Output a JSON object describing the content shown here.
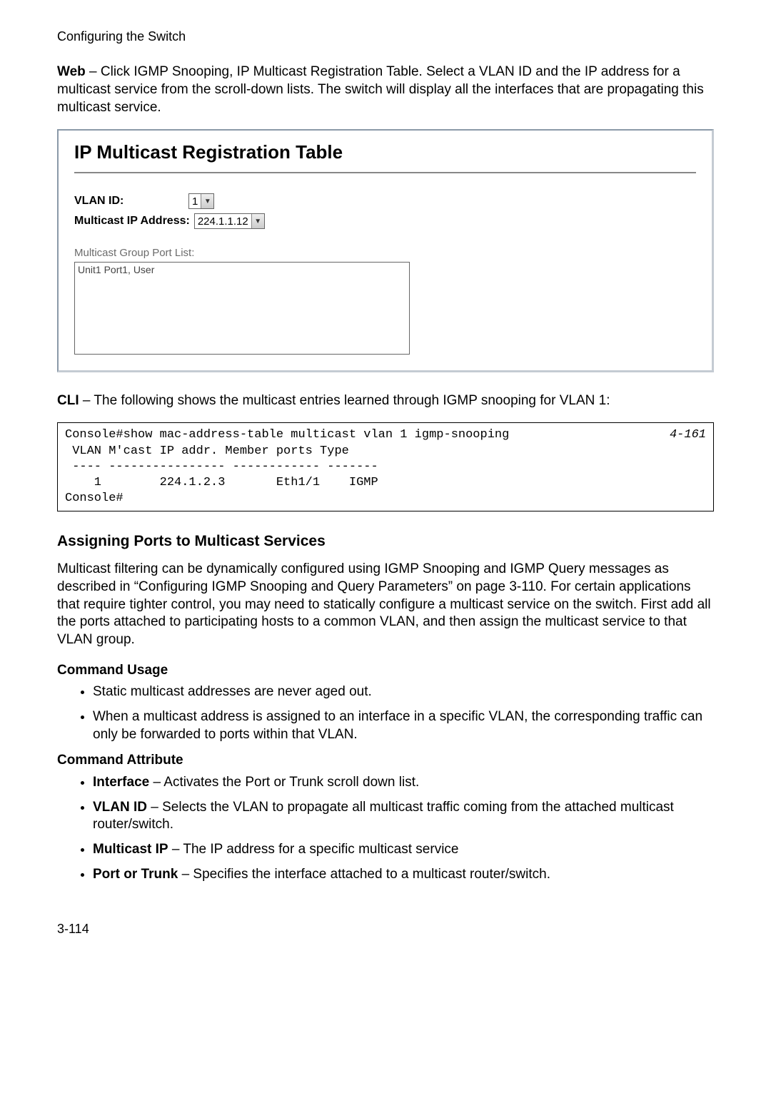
{
  "header": "Configuring the Switch",
  "intro_bold": "Web",
  "intro_text": " – Click IGMP Snooping, IP Multicast Registration Table. Select a VLAN ID and the IP address for a multicast service from the scroll-down lists. The switch will display all the interfaces that are propagating this multicast service.",
  "web_ui": {
    "title": "IP Multicast Registration Table",
    "vlan_label": "VLAN ID:",
    "vlan_value": "1",
    "mip_label": "Multicast IP Address:",
    "mip_value": "224.1.1.12",
    "portlist_label": "Multicast Group Port List:",
    "portlist_value": "Unit1 Port1, User"
  },
  "cli_intro_bold": "CLI",
  "cli_intro_text": " – The following shows the multicast entries learned through IGMP snooping for VLAN 1:",
  "cli": {
    "ref": "4-161",
    "line1": "Console#show mac-address-table multicast vlan 1 igmp-snooping",
    "line2": " VLAN M'cast IP addr. Member ports Type",
    "line3": " ---- ---------------- ------------ -------",
    "line4": "    1        224.1.2.3       Eth1/1    IGMP",
    "line5": "Console#"
  },
  "section": {
    "title": "Assigning Ports to Multicast Services",
    "para": "Multicast filtering can be dynamically configured using IGMP Snooping and IGMP Query messages as described in “Configuring IGMP Snooping and Query Parameters” on page 3-110. For certain applications that require tighter control, you may need to statically configure a multicast service on the switch. First add all the ports attached to participating hosts to a common VLAN, and then assign the multicast service to that VLAN group.",
    "usage_title": "Command Usage",
    "usage_items": [
      "Static multicast addresses are never aged out.",
      "When a multicast address is assigned to an interface in a specific VLAN, the corresponding traffic can only be forwarded to ports within that VLAN."
    ],
    "attr_title": "Command Attribute",
    "attr_items": [
      {
        "b": "Interface",
        "t": " – Activates the Port or Trunk scroll down list."
      },
      {
        "b": "VLAN ID",
        "t": " – Selects the VLAN to propagate all multicast traffic coming from the attached multicast router/switch."
      },
      {
        "b": "Multicast IP",
        "t": " – The IP address for a specific multicast service"
      },
      {
        "b": "Port or Trunk",
        "t": " – Specifies the interface attached to a multicast router/switch."
      }
    ]
  },
  "page_number": "3-114"
}
